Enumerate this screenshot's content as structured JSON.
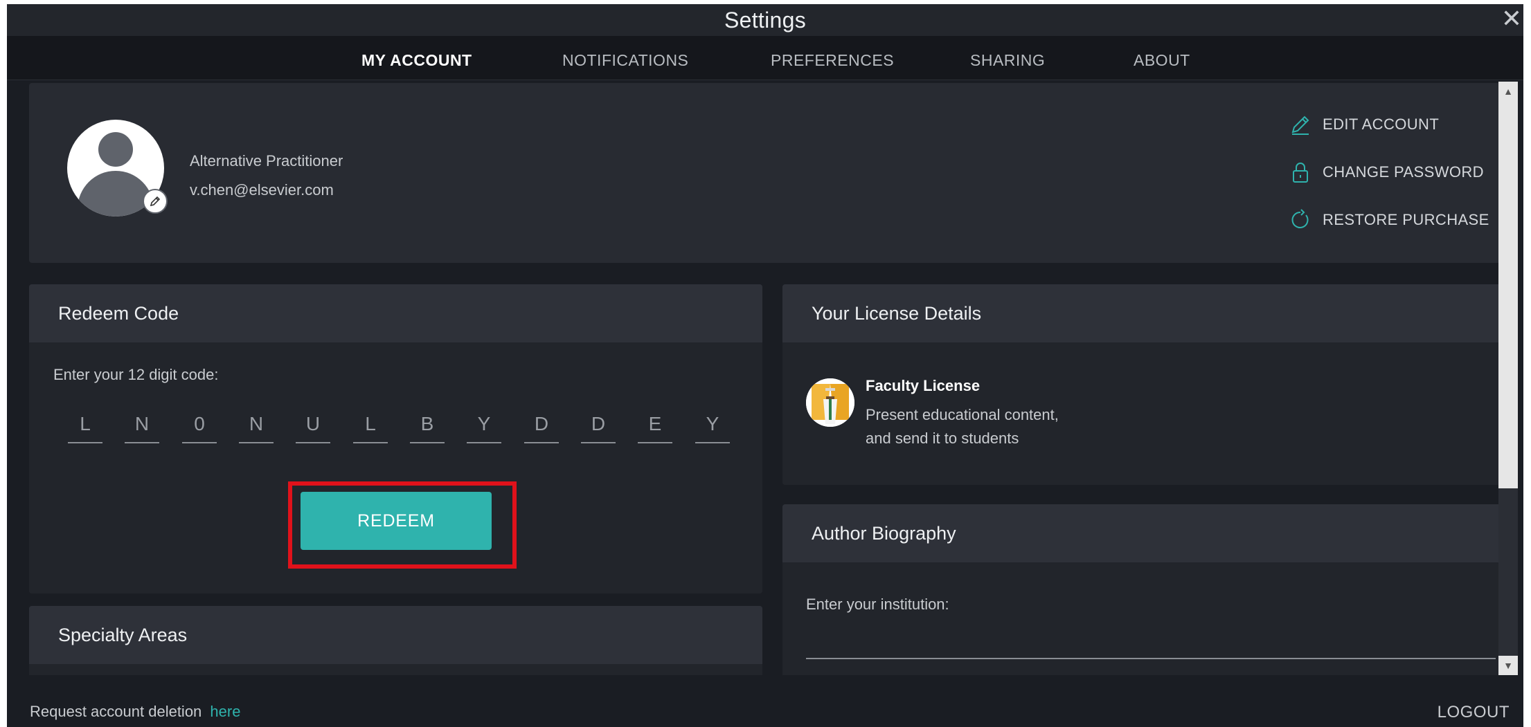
{
  "window": {
    "title": "Settings",
    "close_icon": "close-icon"
  },
  "tabs": [
    {
      "label": "MY ACCOUNT",
      "active": true
    },
    {
      "label": "NOTIFICATIONS",
      "active": false
    },
    {
      "label": "PREFERENCES",
      "active": false
    },
    {
      "label": "SHARING",
      "active": false
    },
    {
      "label": "ABOUT",
      "active": false
    }
  ],
  "profile": {
    "role": "Alternative Practitioner",
    "email": "v.chen@elsevier.com",
    "actions": [
      {
        "label": "EDIT ACCOUNT",
        "icon": "pencil-icon"
      },
      {
        "label": "CHANGE PASSWORD",
        "icon": "lock-icon"
      },
      {
        "label": "RESTORE PURCHASE",
        "icon": "refresh-icon"
      }
    ]
  },
  "redeem": {
    "title": "Redeem Code",
    "label": "Enter your 12 digit code:",
    "code": [
      "L",
      "N",
      "0",
      "N",
      "U",
      "L",
      "B",
      "Y",
      "D",
      "D",
      "E",
      "Y"
    ],
    "button": "REDEEM"
  },
  "specialty": {
    "title": "Specialty Areas"
  },
  "license": {
    "title": "Your License Details",
    "name": "Faculty License",
    "description_line1": "Present educational content,",
    "description_line2": "and send it to students"
  },
  "bio": {
    "title": "Author Biography",
    "label": "Enter your institution:",
    "value": ""
  },
  "footer": {
    "delete_text": "Request account deletion",
    "delete_link": "here",
    "logout": "LOGOUT"
  },
  "colors": {
    "accent": "#2fb3ad",
    "highlight": "#e0121b",
    "background": "#1a1d23"
  }
}
